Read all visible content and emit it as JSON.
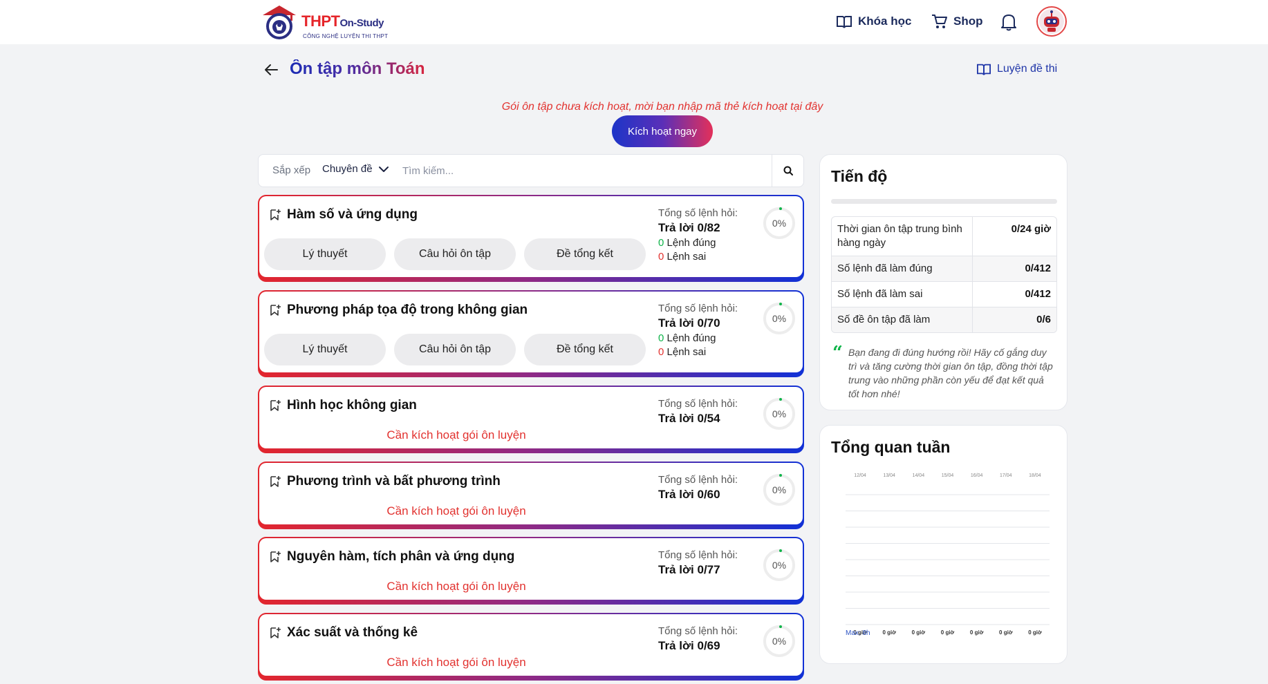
{
  "header": {
    "logo": {
      "brand_main": "THPT",
      "brand_small": "On-Study",
      "tagline": "CÔNG NGHỆ LUYỆN THI THPT"
    },
    "nav": {
      "courses": "Khóa học",
      "shop": "Shop"
    }
  },
  "page": {
    "title": "Ôn tập môn Toán",
    "practice_link": "Luyện đề thi",
    "activate_message": "Gói ôn tập chưa kích hoạt, mời bạn nhập mã thẻ kích hoạt tại đây",
    "activate_button": "Kích hoạt ngay"
  },
  "search": {
    "sort_label": "Sắp xếp",
    "sort_value": "Chuyên đề",
    "placeholder": "Tìm kiếm..."
  },
  "topics": [
    {
      "title": "Hàm số và ứng dụng",
      "total_label": "Tổng số lệnh hỏi:",
      "answered": "Trả lời 0/82",
      "correct_count": "0",
      "correct_label": "Lệnh đúng",
      "wrong_count": "0",
      "wrong_label": "Lệnh sai",
      "percent": "0%",
      "buttons": [
        "Lý thuyết",
        "Câu hỏi ôn tập",
        "Đề tổng kết"
      ]
    },
    {
      "title": "Phương pháp tọa độ trong không gian",
      "total_label": "Tổng số lệnh hỏi:",
      "answered": "Trả lời 0/70",
      "correct_count": "0",
      "correct_label": "Lệnh đúng",
      "wrong_count": "0",
      "wrong_label": "Lệnh sai",
      "percent": "0%",
      "buttons": [
        "Lý thuyết",
        "Câu hỏi ôn tập",
        "Đề tổng kết"
      ]
    },
    {
      "title": "Hình học không gian",
      "total_label": "Tổng số lệnh hỏi:",
      "answered": "Trả lời 0/54",
      "percent": "0%",
      "lock_message": "Cần kích hoạt gói ôn luyện"
    },
    {
      "title": "Phương trình và bất phương trình",
      "total_label": "Tổng số lệnh hỏi:",
      "answered": "Trả lời 0/60",
      "percent": "0%",
      "lock_message": "Cần kích hoạt gói ôn luyện"
    },
    {
      "title": "Nguyên hàm, tích phân và ứng dụng",
      "total_label": "Tổng số lệnh hỏi:",
      "answered": "Trả lời 0/77",
      "percent": "0%",
      "lock_message": "Cần kích hoạt gói ôn luyện"
    },
    {
      "title": "Xác suất và thống kê",
      "total_label": "Tổng số lệnh hỏi:",
      "answered": "Trả lời 0/69",
      "percent": "0%",
      "lock_message": "Cần kích hoạt gói ôn luyện"
    }
  ],
  "progress_panel": {
    "title": "Tiến độ",
    "progress_value": 0,
    "rows": [
      {
        "label": "Thời gian ôn tập trung bình hàng ngày",
        "value": "0/24 giờ"
      },
      {
        "label": "Số lệnh đã làm đúng",
        "value": "0/412"
      },
      {
        "label": "Số lệnh đã làm sai",
        "value": "0/412"
      },
      {
        "label": "Số đề ôn tập đã làm",
        "value": "0/6"
      }
    ],
    "quote": "Bạn đang đi đúng hướng rồi! Hãy cố gắng duy trì và tăng cường thời gian ôn tập, đồng thời tập trung vào những phần còn yếu để đạt kết quả tốt hơn nhé!"
  },
  "week_panel": {
    "title": "Tổng quan tuần"
  },
  "chart_data": {
    "type": "bar",
    "categories": [
      "12/04",
      "13/04",
      "14/04",
      "15/04",
      "16/04",
      "17/04",
      "18/04"
    ],
    "values": [
      0,
      0,
      0,
      0,
      0,
      0,
      0
    ],
    "value_labels": [
      "0 giờ",
      "0 giờ",
      "0 giờ",
      "0 giờ",
      "0 giờ",
      "0 giờ",
      "0 giờ"
    ],
    "ylim": [
      0,
      8
    ],
    "gridlines": 8,
    "max_label": "Max: 8h",
    "colors": {
      "bar": "#10b44a",
      "grid": "#e3e5ea"
    }
  },
  "colors": {
    "accent_blue": "#1d35c8",
    "accent_red": "#e2322f",
    "green": "#10b44a"
  }
}
